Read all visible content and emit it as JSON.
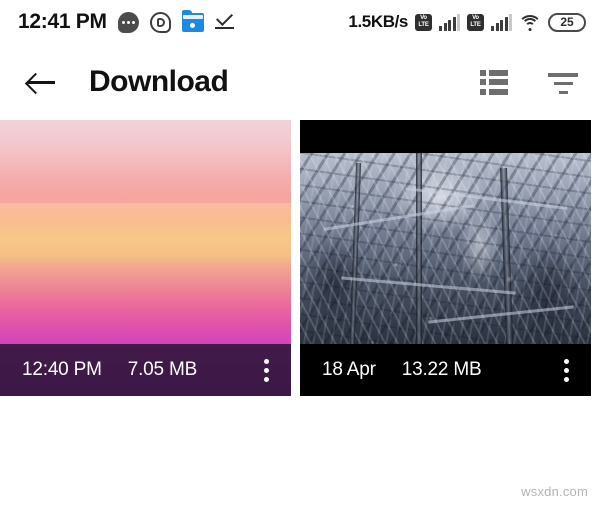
{
  "status_bar": {
    "clock": "12:41 PM",
    "network_speed": "1.5KB/s",
    "battery_level": "25",
    "icons": [
      {
        "name": "sms-icon",
        "label": "sms"
      },
      {
        "name": "whatsapp-icon",
        "label": "whatsapp"
      },
      {
        "name": "file-manager-icon",
        "label": "file-manager"
      },
      {
        "name": "download-complete-icon",
        "label": "download-complete"
      }
    ],
    "volte_top": "Vo",
    "volte_bottom": "LTE",
    "sim1_volte": "VoLTE",
    "sim2_volte": "VoLTE",
    "wifi": "wifi-connected"
  },
  "app_bar": {
    "title": "Download",
    "back_label": "Back",
    "grid_view_label": "List view",
    "sort_label": "Sort"
  },
  "gallery": {
    "items": [
      {
        "thumbnail": "sunset-gradient",
        "time": "12:40 PM",
        "size": "7.05 MB",
        "overlay_style": "dark-purple",
        "menu_label": "More options"
      },
      {
        "thumbnail": "snowy-forest",
        "time": "18 Apr",
        "size": "13.22 MB",
        "overlay_style": "black",
        "menu_label": "More options"
      }
    ]
  },
  "footer": {
    "watermark": "wsxdn.com"
  },
  "colors": {
    "page_background": "#ffffff",
    "text_primary": "#111111",
    "icon_gray": "#6e6e6e",
    "overlay_purple": "#2e1638",
    "overlay_black": "#000000",
    "folder_blue": "#1c8ae0"
  }
}
